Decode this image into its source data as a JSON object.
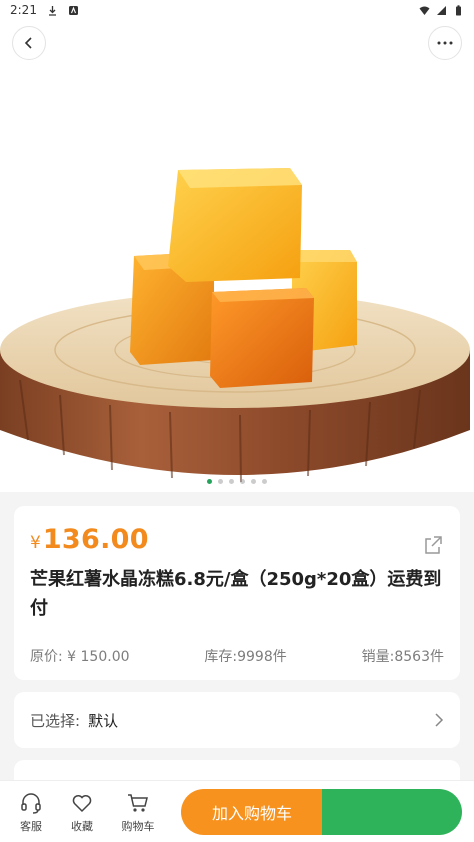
{
  "status_bar": {
    "time": "2:21"
  },
  "product": {
    "currency": "¥",
    "price": "136.00",
    "title": "芒果红薯水晶冻糕6.8元/盒（250g*20盒）运费到付",
    "original_price": "原价: ¥ 150.00",
    "stock": "库存:9998件",
    "sales": "销量:8563件"
  },
  "selection": {
    "label": "已选择:",
    "value": "默认"
  },
  "bottom_bar": {
    "service_label": "客服",
    "favorite_label": "收藏",
    "cart_label": "购物车",
    "add_to_cart_label": "加入购物车"
  },
  "carousel": {
    "total": 6,
    "active_index": 0
  },
  "colors": {
    "accent": "#f28a1e",
    "cart_button": "#f7921e",
    "buy_button": "#2fb35a"
  }
}
